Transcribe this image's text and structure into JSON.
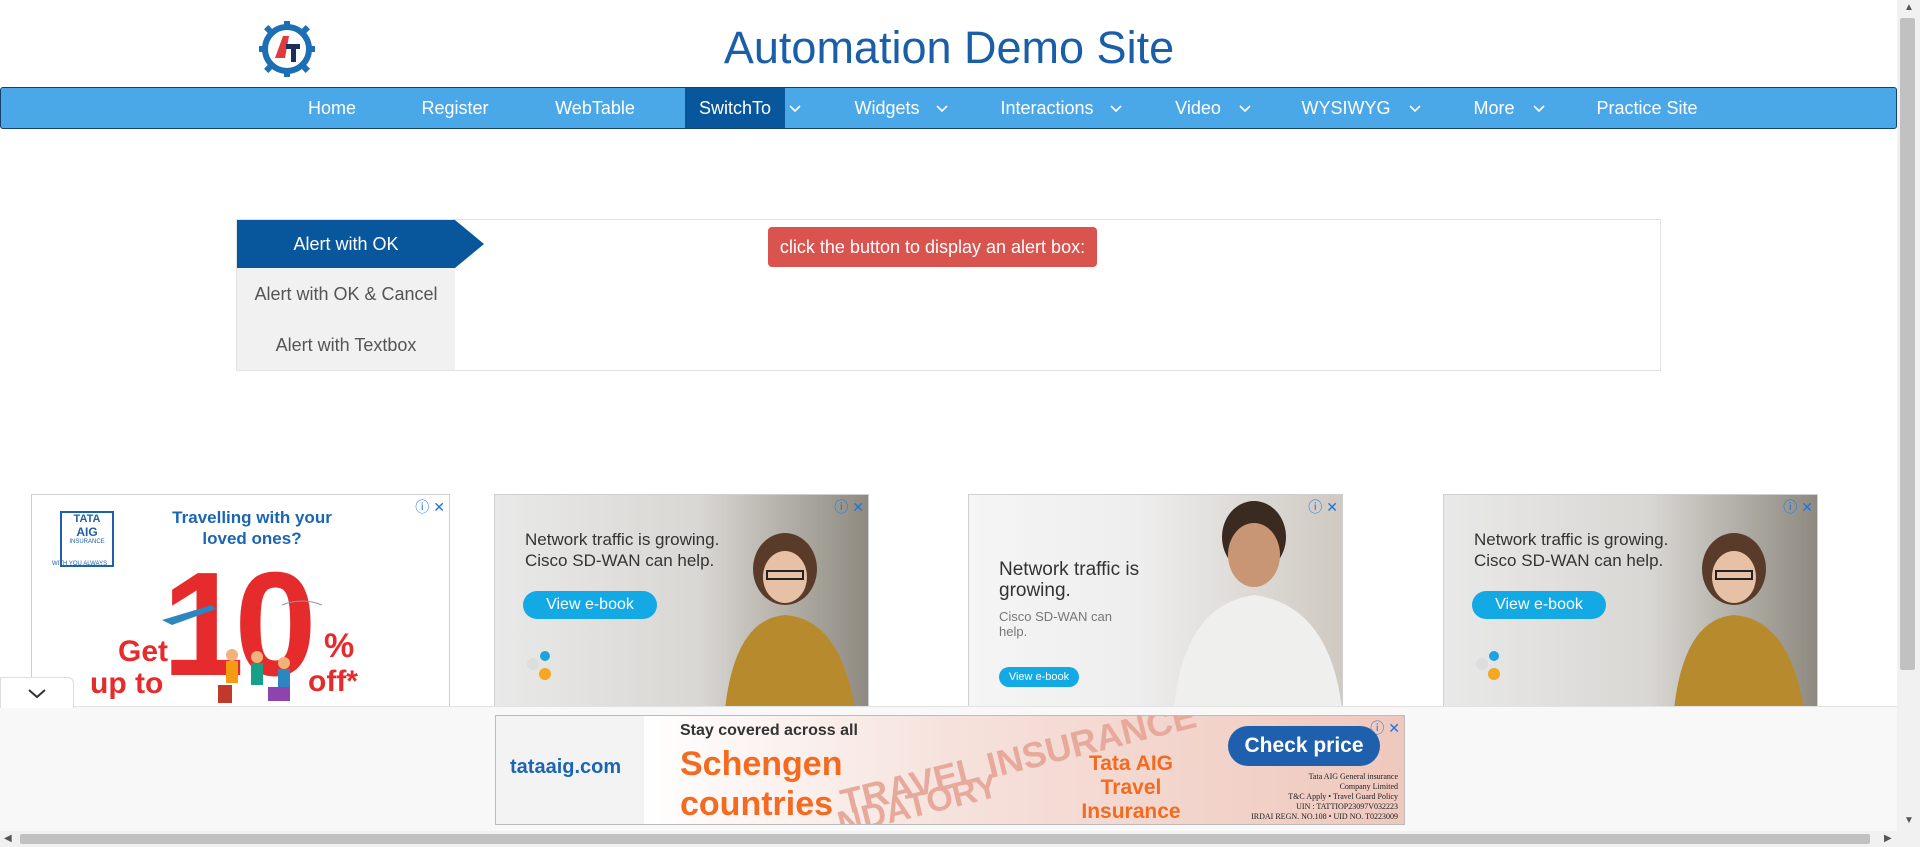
{
  "header": {
    "site_title": "Automation Demo Site",
    "logo_letters": "AT"
  },
  "nav": {
    "items": [
      {
        "label": "Home"
      },
      {
        "label": "Register"
      },
      {
        "label": "WebTable"
      },
      {
        "label": "SwitchTo",
        "active": true,
        "has_dropdown": true
      },
      {
        "label": "Widgets",
        "has_dropdown": true
      },
      {
        "label": "Interactions",
        "has_dropdown": true
      },
      {
        "label": "Video",
        "has_dropdown": true
      },
      {
        "label": "WYSIWYG",
        "has_dropdown": true
      },
      {
        "label": "More",
        "has_dropdown": true
      },
      {
        "label": "Practice Site"
      }
    ]
  },
  "alerts": {
    "tabs": [
      {
        "label": "Alert with OK",
        "active": true
      },
      {
        "label": "Alert with OK & Cancel"
      },
      {
        "label": "Alert with Textbox"
      }
    ],
    "button_label": "click the button to display an alert box:"
  },
  "ads": {
    "tata": {
      "brand": "TATA",
      "brand2": "AIG",
      "brand3": "INSURANCE",
      "tagline_small": "WITH YOU ALWAYS",
      "headline": "Travelling with your loved ones?",
      "get": "Get",
      "upto": "up to",
      "big": "10",
      "pct": "%",
      "off": "off*"
    },
    "cisco1": {
      "headline": "Network traffic is growing. Cisco SD-WAN can help.",
      "button": "View e-book"
    },
    "cisco2": {
      "headline": "Network traffic is growing.",
      "sub": "Cisco SD-WAN can help.",
      "button": "View e-book"
    },
    "cisco3": {
      "headline": "Network traffic is growing. Cisco SD-WAN can help.",
      "button": "View e-book"
    },
    "bottom": {
      "domain": "tataaig.com",
      "stay": "Stay covered across all",
      "schengen": "Schengen countries",
      "stamp": "TRAVEL INSURANCE",
      "stamp2": "NDATORY",
      "product": "Tata AIG Travel Insurance",
      "cta": "Check price",
      "legal1": "Tata AIG General insurance",
      "legal2": "Company Limited",
      "legal3": "T&C Apply  •  Travel Guard Policy",
      "legal4": "UIN : TATTIOP23097V032223",
      "legal5": "IRDAI REGN. NO.108  •  UID NO. T0223009"
    }
  },
  "colors": {
    "brand_blue": "#1a5ea8",
    "nav_bg": "#4aa8e8",
    "nav_active": "#08569c",
    "alert_red": "#d9534f",
    "cisco_blue": "#12a9e5"
  }
}
